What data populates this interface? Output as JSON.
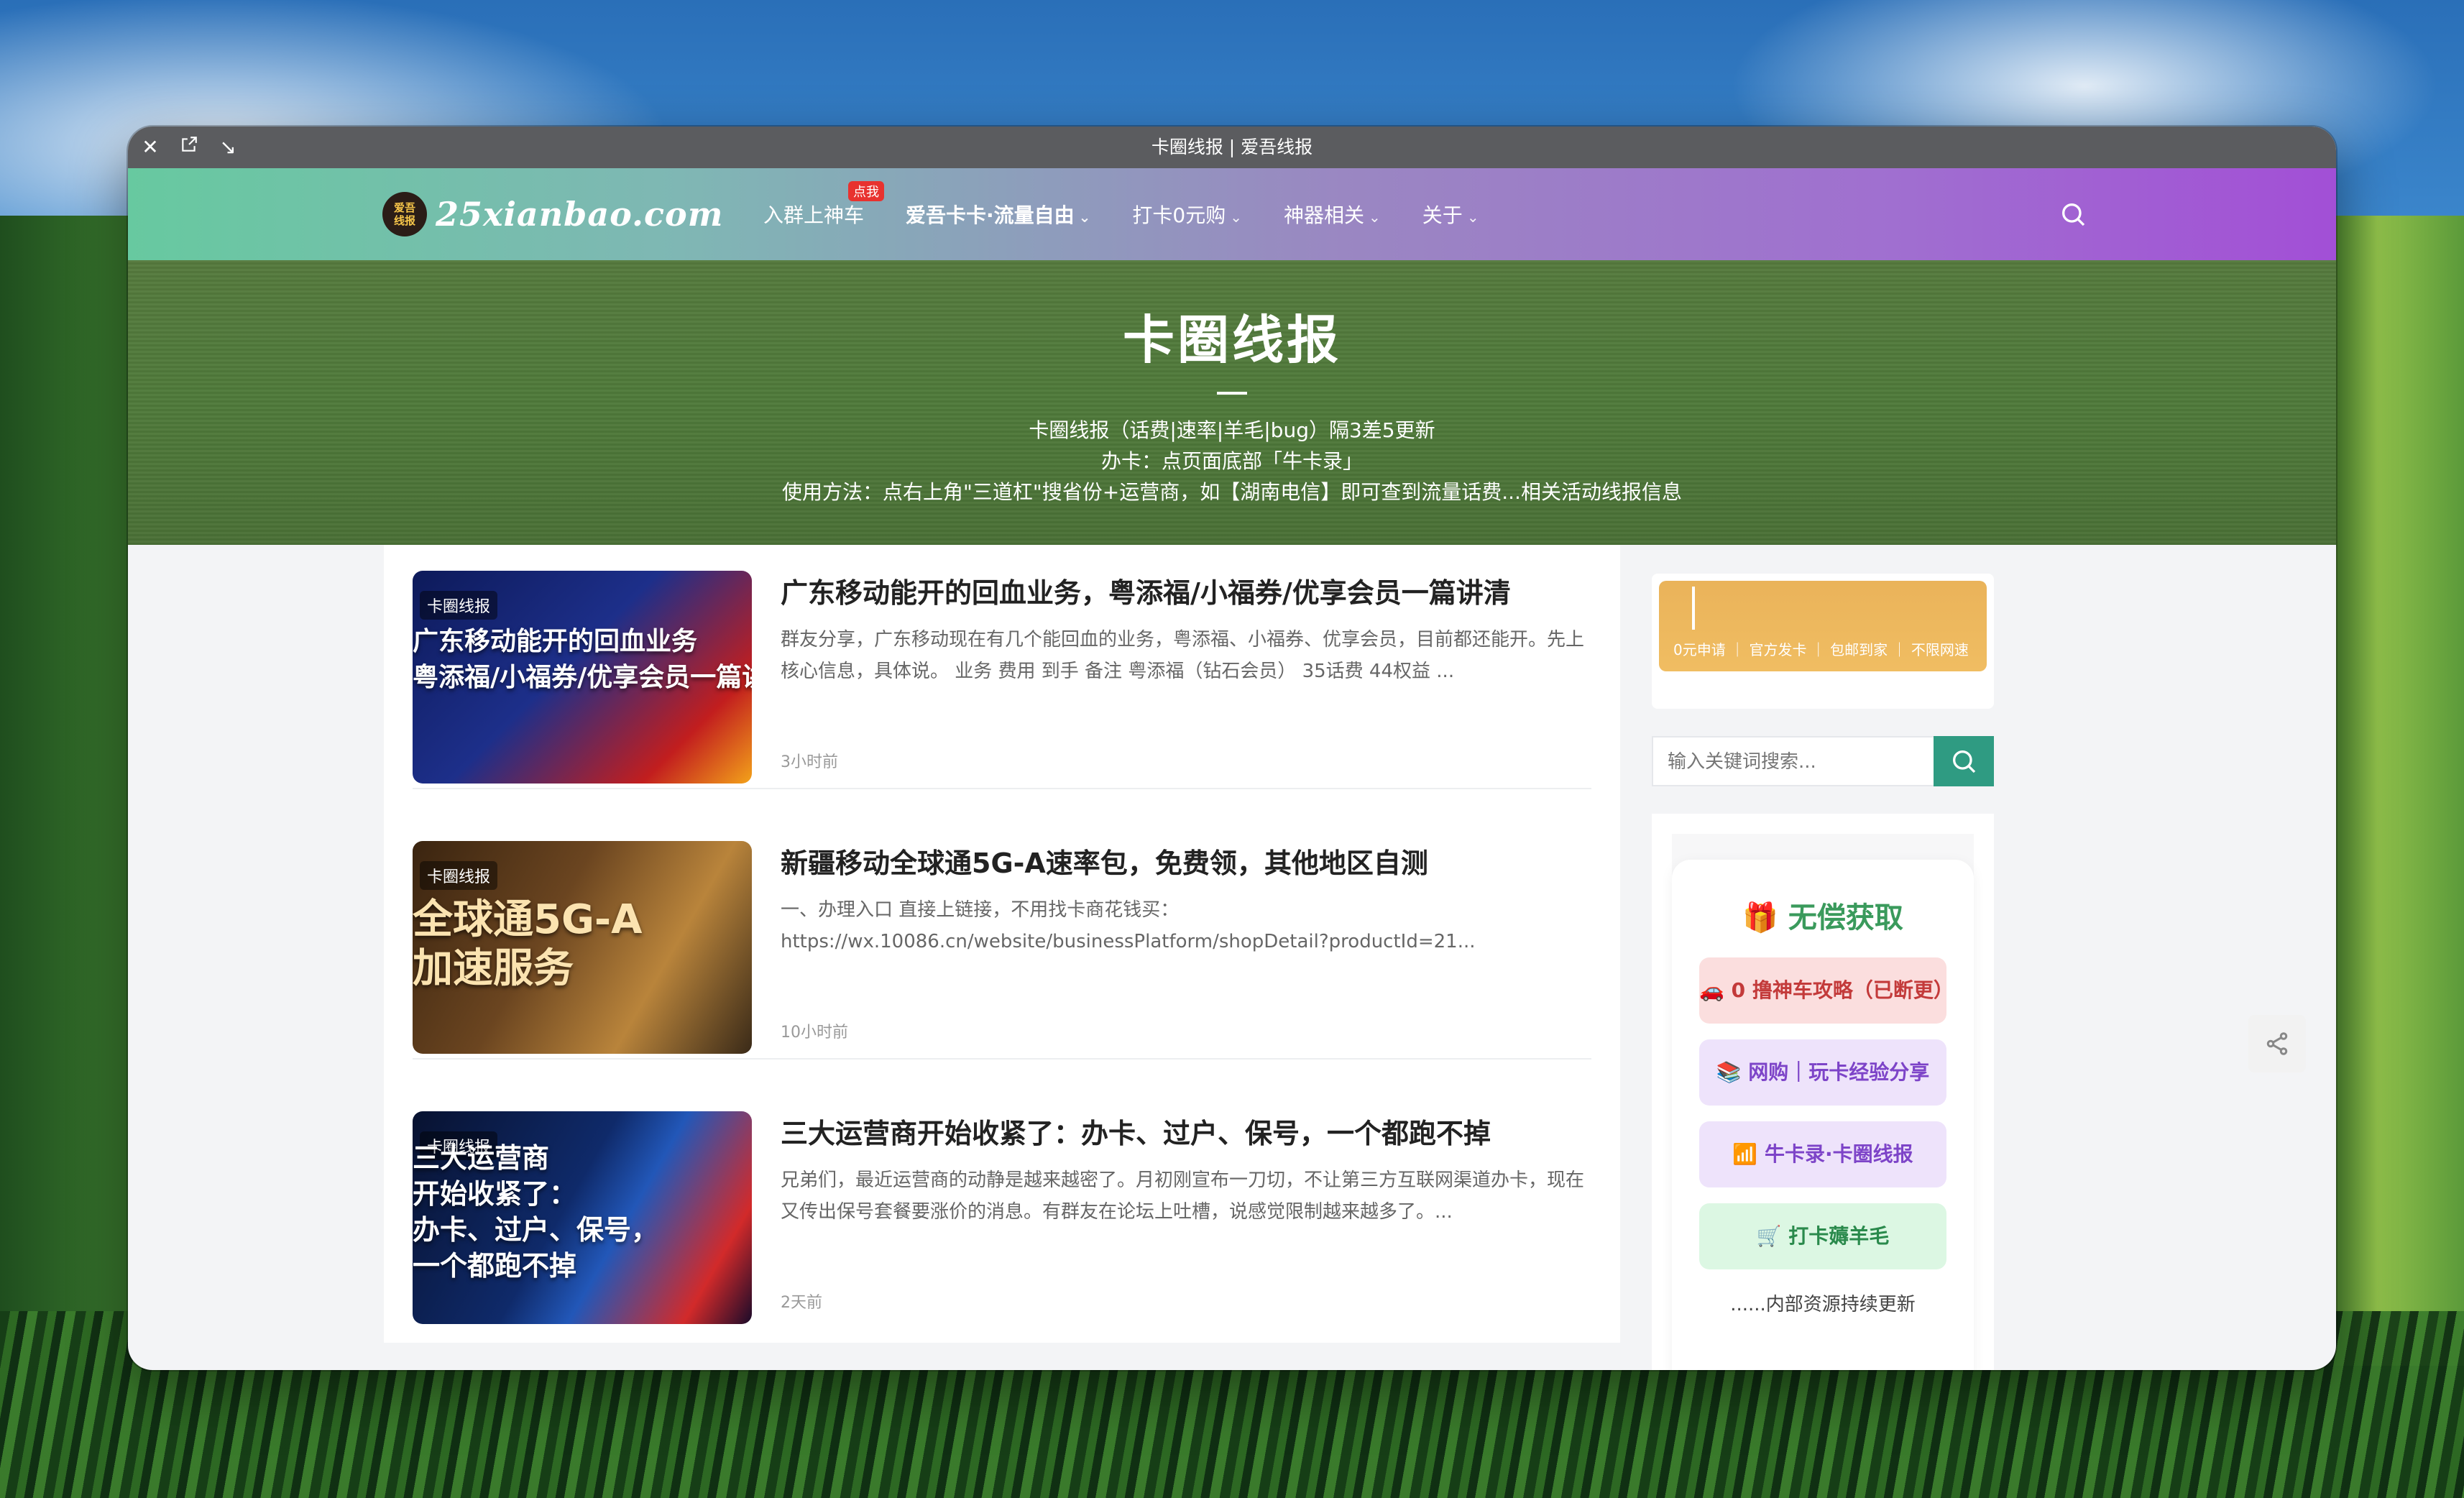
{
  "window": {
    "title": "卡圈线报 | 爱吾线报"
  },
  "nav": {
    "logo_badge": "爱吾\n线报",
    "logo_text": "25xianbao.com",
    "items": [
      {
        "label": "入群上神车",
        "badge": "点我"
      },
      {
        "label": "爱吾卡卡·流量自由"
      },
      {
        "label": "打卡0元购"
      },
      {
        "label": "神器相关"
      },
      {
        "label": "关于"
      }
    ]
  },
  "hero": {
    "title": "卡圈线报",
    "line1": "卡圈线报（话费|速率|羊毛|bug）隔3差5更新",
    "line2": "办卡：点页面底部「牛卡录」",
    "line3": "使用方法：点右上角\"三道杠\"搜省份+运营商，如【湖南电信】即可查到流量话费...相关活动线报信息"
  },
  "posts": [
    {
      "tag": "卡圈线报",
      "thumb_text": "广东移动能开的回血业务\n粤添福/小福券/优享会员一篇讲清",
      "title": "广东移动能开的回血业务，粤添福/小福券/优享会员一篇讲清",
      "excerpt": "群友分享，广东移动现在有几个能回血的业务，粤添福、小福券、优享会员，目前都还能开。先上核心信息，具体说。 业务 费用 到手 备注 粤添福（钻石会员） 35话费 44权益 ...",
      "time": "3小时前"
    },
    {
      "tag": "卡圈线报",
      "thumb_text": "全球通5G-A\n加速服务",
      "title": "新疆移动全球通5G-A速率包，免费领，其他地区自测",
      "excerpt": "一、办理入口 直接上链接，不用找卡商花钱买： https://wx.10086.cn/website/businessPlatform/shopDetail?productId=21...",
      "time": "10小时前"
    },
    {
      "tag": "卡圈线报",
      "thumb_text": "三大运营商\n开始收紧了：\n办卡、过户、保号，\n一个都跑不掉",
      "title": "三大运营商开始收紧了：办卡、过户、保号，一个都跑不掉",
      "excerpt": "兄弟们，最近运营商的动静是越来越密了。月初刚宣布一刀切，不让第三方互联网渠道办卡，现在又传出保号套餐要涨价的消息。有群友在论坛上吐槽，说感觉限制越来越多了。...",
      "time": "2天前"
    }
  ],
  "sidebar": {
    "ad": {
      "row": "0元申请 ｜ 官方发卡 ｜ 包邮到家 ｜ 不限网速"
    },
    "search_placeholder": "输入关键词搜索...",
    "free_title": "🎁 无偿获取",
    "buttons": [
      "🚗 0 撸神车攻略（已断更）",
      "📚 网购｜玩卡经验分享",
      "📶 牛卡录·卡圈线报",
      "🛒 打卡薅羊毛"
    ],
    "note": "......内部资源持续更新"
  },
  "colors": {
    "nav_start": "#67c9a0",
    "nav_end": "#a24fd6",
    "accent_green": "#2f9b82"
  }
}
